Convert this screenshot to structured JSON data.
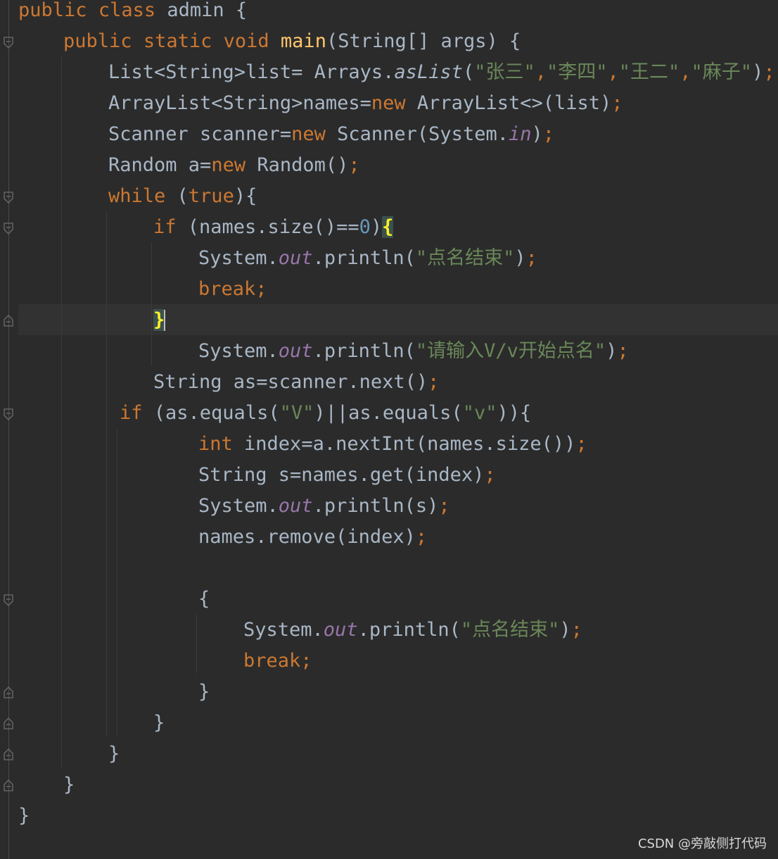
{
  "editor": {
    "watermark": "CSDN @旁敲侧打代码",
    "lines": {
      "l1": {
        "kw1": "public",
        "kw2": "class",
        "rest": " admin {"
      },
      "l2": {
        "kw1": "public",
        "kw2": "static",
        "kw3": "void",
        "method": "main",
        "rest": "(String[] args) {"
      },
      "l3": {
        "a": "List<String>list= Arrays.",
        "call": "asList",
        "b": "(",
        "s1": "\"张三\"",
        "c1": ",",
        "s2": "\"李四\"",
        "c2": ",",
        "s3": "\"王二\"",
        "c3": ",",
        "s4": "\"麻子\"",
        "d": ")",
        "semi": ";"
      },
      "l4": {
        "a": "ArrayList<String>names=",
        "kw": "new",
        "b": " ArrayList<>(list)",
        "semi": ";"
      },
      "l5": {
        "a": "Scanner scanner=",
        "kw": "new",
        "b": " Scanner(System.",
        "field": "in",
        "c": ")",
        "semi": ";"
      },
      "l6": {
        "a": "Random a=",
        "kw": "new",
        "b": " Random()",
        "semi": ";"
      },
      "l7": {
        "kw": "while",
        "a": " (",
        "kw2": "true",
        "b": "){"
      },
      "l8": {
        "kw": "if",
        "a": " (names.size()==",
        "num": "0",
        "b": ")",
        "brace": "{"
      },
      "l9": {
        "a": "System.",
        "field": "out",
        "b": ".println(",
        "str": "\"点名结束\"",
        "c": ")",
        "semi": ";"
      },
      "l10": {
        "kw": "break",
        "semi": ";"
      },
      "l11": {
        "brace": "}"
      },
      "l12": {
        "a": "System.",
        "field": "out",
        "b": ".println(",
        "str": "\"请输入V/v开始点名\"",
        "c": ")",
        "semi": ";"
      },
      "l13": {
        "a": "String as=scanner.next()",
        "semi": ";"
      },
      "l14": {
        "kw": "if",
        "a": " (as.equals(",
        "s1": "\"V\"",
        "b": ")||as.equals(",
        "s2": "\"v\"",
        "c": ")){"
      },
      "l15": {
        "kw": "int",
        "a": " index=a.nextInt(names.size())",
        "semi": ";"
      },
      "l16": {
        "a": "String s=names.get(index)",
        "semi": ";"
      },
      "l17": {
        "a": "System.",
        "field": "out",
        "b": ".println(s)",
        "semi": ";"
      },
      "l18": {
        "a": "names.remove(index)",
        "semi": ";"
      },
      "l19": {
        "a": "{"
      },
      "l20": {
        "a": "System.",
        "field": "out",
        "b": ".println(",
        "str": "\"点名结束\"",
        "c": ")",
        "semi": ";"
      },
      "l21": {
        "kw": "break",
        "semi": ";"
      },
      "l22": {
        "a": "}"
      },
      "l23": {
        "a": "}"
      },
      "l24": {
        "a": "}"
      },
      "l25": {
        "a": "}"
      },
      "l26": {
        "a": "}"
      }
    }
  }
}
